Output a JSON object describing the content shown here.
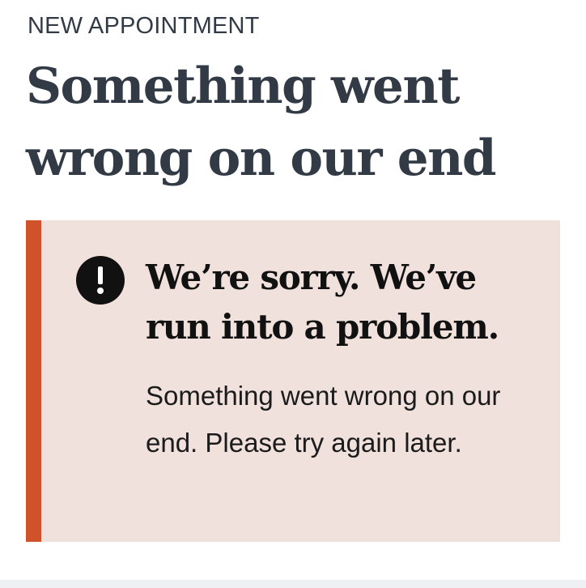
{
  "header": {
    "eyebrow": "NEW APPOINTMENT",
    "title": "Something went wrong on our end"
  },
  "alert": {
    "heading": "We’re sorry. We’ve run into a problem.",
    "body": "Something went wrong on our end. Please try again later.",
    "icon": "exclamation-circle-icon"
  },
  "colors": {
    "text": "#323a45",
    "alert_background": "#f0e1dc",
    "alert_accent": "#d0522a",
    "icon_fill": "#111111"
  }
}
